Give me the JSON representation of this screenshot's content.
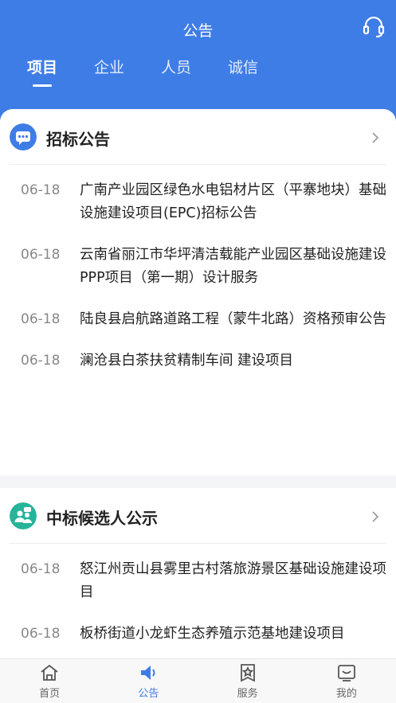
{
  "header": {
    "title": "公告",
    "tabs": [
      {
        "label": "项目",
        "active": true
      },
      {
        "label": "企业",
        "active": false
      },
      {
        "label": "人员",
        "active": false
      },
      {
        "label": "诚信",
        "active": false
      }
    ],
    "support_icon": "headset-icon"
  },
  "sections": [
    {
      "title": "招标公告",
      "icon": "chat-bubble-icon",
      "icon_color": "#3f7de6",
      "items": [
        {
          "date": "06-18",
          "text": "广南产业园区绿色水电铝材片区（平寨地块）基础设施建设项目(EPC)招标公告"
        },
        {
          "date": "06-18",
          "text": "云南省丽江市华坪清洁载能产业园区基础设施建设PPP项目（第一期）设计服务"
        },
        {
          "date": "06-18",
          "text": "陆良县启航路道路工程（蒙牛北路）资格预审公告"
        },
        {
          "date": "06-18",
          "text": "澜沧县白茶扶贫精制车间 建设项目"
        }
      ]
    },
    {
      "title": "中标候选人公示",
      "icon": "people-icon",
      "icon_color": "#27b49a",
      "items": [
        {
          "date": "06-18",
          "text": "怒江州贡山县雾里古村落旅游景区基础设施建设项目"
        },
        {
          "date": "06-18",
          "text": "板桥街道小龙虾生态养殖示范基地建设项目"
        }
      ]
    }
  ],
  "tabbar": [
    {
      "label": "首页",
      "icon": "home-icon",
      "active": false
    },
    {
      "label": "公告",
      "icon": "speaker-icon",
      "active": true
    },
    {
      "label": "服务",
      "icon": "star-badge-icon",
      "active": false
    },
    {
      "label": "我的",
      "icon": "profile-icon",
      "active": false
    }
  ],
  "colors": {
    "primary": "#3f7de6",
    "teal": "#27b49a"
  }
}
